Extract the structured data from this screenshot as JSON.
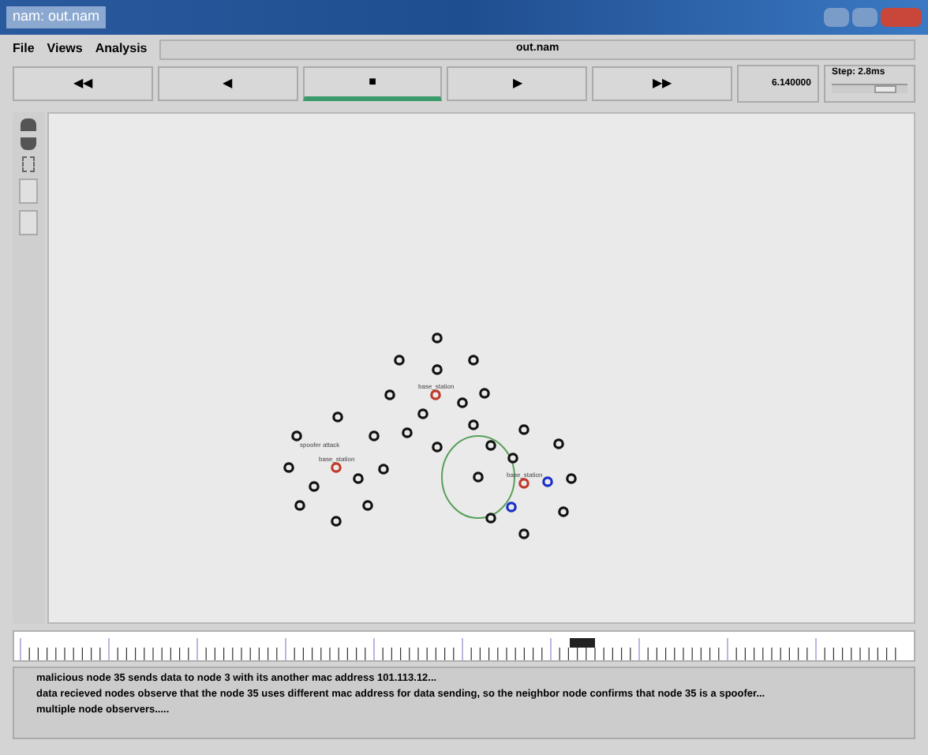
{
  "window": {
    "title": "nam: out.nam"
  },
  "menu": [
    "File",
    "Views",
    "Analysis"
  ],
  "file_name": "out.nam",
  "controls": [
    {
      "symbol": "◀◀",
      "selected": false
    },
    {
      "symbol": "◀",
      "selected": false
    },
    {
      "symbol": "■",
      "selected": true
    },
    {
      "symbol": "▶",
      "selected": false
    },
    {
      "symbol": "▶▶",
      "selected": false
    }
  ],
  "time": "6.140000",
  "step": {
    "label": "Step: 2.8ms",
    "level": 0.7
  },
  "nodes": [
    {
      "kind": "normal"
    },
    {
      "kind": "normal"
    },
    {
      "kind": "normal"
    },
    {
      "kind": "normal"
    },
    {
      "kind": "normal"
    },
    {
      "kind": "station",
      "label": "base_station"
    },
    {
      "kind": "normal"
    },
    {
      "kind": "normal"
    },
    {
      "kind": "normal"
    },
    {
      "kind": "normal"
    },
    {
      "kind": "normal"
    },
    {
      "kind": "normal"
    },
    {
      "kind": "normal"
    },
    {
      "kind": "normal"
    },
    {
      "kind": "normal"
    },
    {
      "kind": "normal"
    },
    {
      "kind": "normal"
    },
    {
      "kind": "normal"
    },
    {
      "kind": "normal"
    },
    {
      "kind": "normal"
    },
    {
      "kind": "station",
      "label": "base_station"
    },
    {
      "kind": "normal"
    },
    {
      "kind": "normal"
    },
    {
      "kind": "normal"
    },
    {
      "kind": "station",
      "label": "base_station"
    },
    {
      "kind": "spoofer"
    },
    {
      "kind": "normal"
    },
    {
      "kind": "normal"
    },
    {
      "kind": "normal"
    },
    {
      "kind": "normal"
    },
    {
      "kind": "spoofer"
    },
    {
      "kind": "normal"
    },
    {
      "kind": "normal"
    },
    {
      "kind": "normal"
    },
    {
      "kind": "normal"
    }
  ],
  "annotation": "spoofer attack",
  "log": [
    "malicious node 35 sends data to node 3 with its another mac address 101.113.12...",
    "data recieved nodes observe that the node 35 uses different mac address for data sending, so the neighbor node confirms that node 35 is a spoofer...",
    "multiple node observers....."
  ]
}
